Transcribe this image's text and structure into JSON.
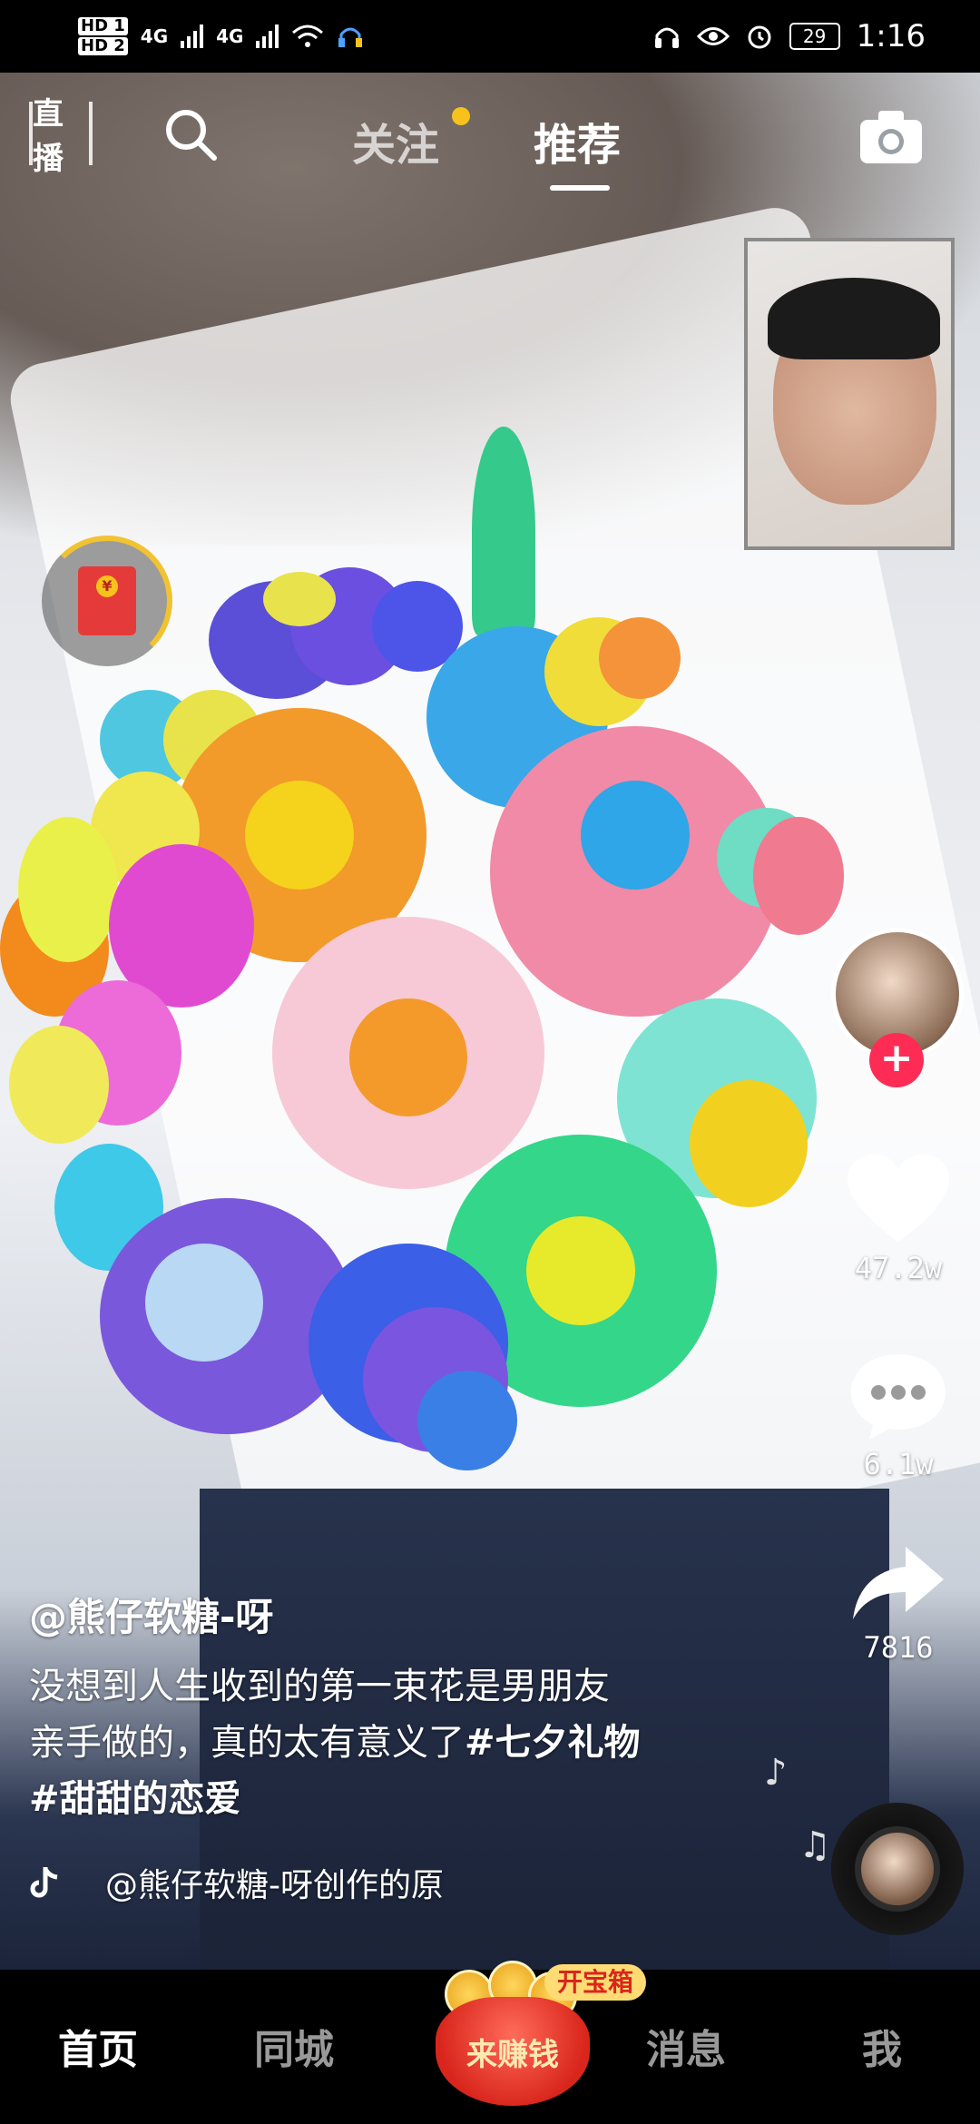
{
  "status_bar": {
    "hd1": "HD 1",
    "hd2": "HD 2",
    "network1": "4G",
    "network2": "4G",
    "battery": "29",
    "time": "1:16"
  },
  "top_nav": {
    "live_label": "直播",
    "tabs": [
      {
        "label": "关注",
        "has_dot": true
      },
      {
        "label": "推荐",
        "active": true
      }
    ]
  },
  "video": {
    "author": "@熊仔软糖-呀",
    "description_line1": "没想到人生收到的第一束花是男朋友",
    "description_line2": "亲手做的，真的太有意义了",
    "hashtag1": "#七夕礼物",
    "hashtag2": "#甜甜的恋爱",
    "music": "@熊仔软糖-呀创作的原"
  },
  "actions": {
    "likes": "47.2w",
    "comments": "6.1w",
    "shares": "7816"
  },
  "bottom_nav": {
    "home": "首页",
    "city": "同城",
    "earn": "来赚钱",
    "treasure": "开宝箱",
    "messages": "消息",
    "me": "我"
  },
  "colors": {
    "accent_red": "#fe2c55",
    "dot_yellow": "#f6c21b"
  }
}
